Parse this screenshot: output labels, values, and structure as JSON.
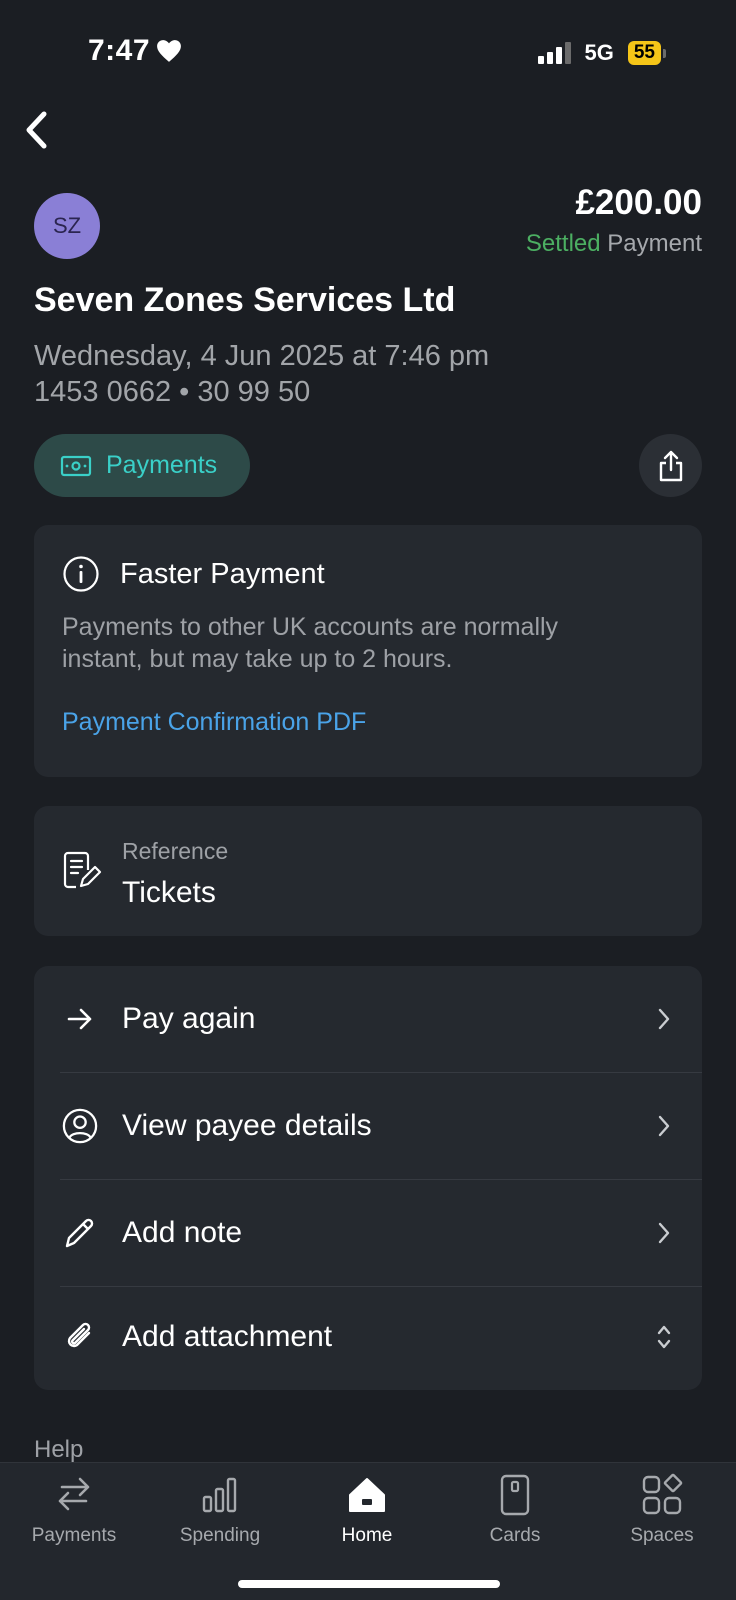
{
  "status_bar": {
    "time": "7:47",
    "network": "5G",
    "battery": "55"
  },
  "transaction": {
    "avatar_initials": "SZ",
    "amount": "£200.00",
    "state": "Settled",
    "kind": "Payment",
    "merchant": "Seven Zones Services Ltd",
    "datetime": "Wednesday, 4 Jun 2025 at 7:46 pm",
    "account": "1453 0662 • 30 99 50",
    "category": "Payments"
  },
  "info_card": {
    "title": "Faster Payment",
    "description": "Payments to other UK accounts are normally instant, but may take up to 2 hours.",
    "link": "Payment Confirmation PDF"
  },
  "reference": {
    "label": "Reference",
    "value": "Tickets"
  },
  "actions": [
    {
      "label": "Pay again",
      "icon": "arrow-right-icon",
      "chevron": "chevron-right-icon"
    },
    {
      "label": "View payee details",
      "icon": "user-circle-icon",
      "chevron": "chevron-right-icon"
    },
    {
      "label": "Add note",
      "icon": "pencil-icon",
      "chevron": "chevron-right-icon"
    },
    {
      "label": "Add attachment",
      "icon": "paperclip-icon",
      "chevron": "chevron-up-down-icon"
    }
  ],
  "help_label": "Help",
  "tabs": [
    {
      "label": "Payments",
      "icon": "transfer-arrows-icon"
    },
    {
      "label": "Spending",
      "icon": "bar-chart-icon"
    },
    {
      "label": "Home",
      "icon": "home-icon",
      "active": true
    },
    {
      "label": "Cards",
      "icon": "card-icon"
    },
    {
      "label": "Spaces",
      "icon": "spaces-grid-icon"
    }
  ],
  "colors": {
    "background": "#1b1e23",
    "card": "#25292f",
    "settled": "#4caf62",
    "link": "#4aa3e8",
    "chip_text": "#3ad0c8",
    "battery": "#f5c518"
  }
}
